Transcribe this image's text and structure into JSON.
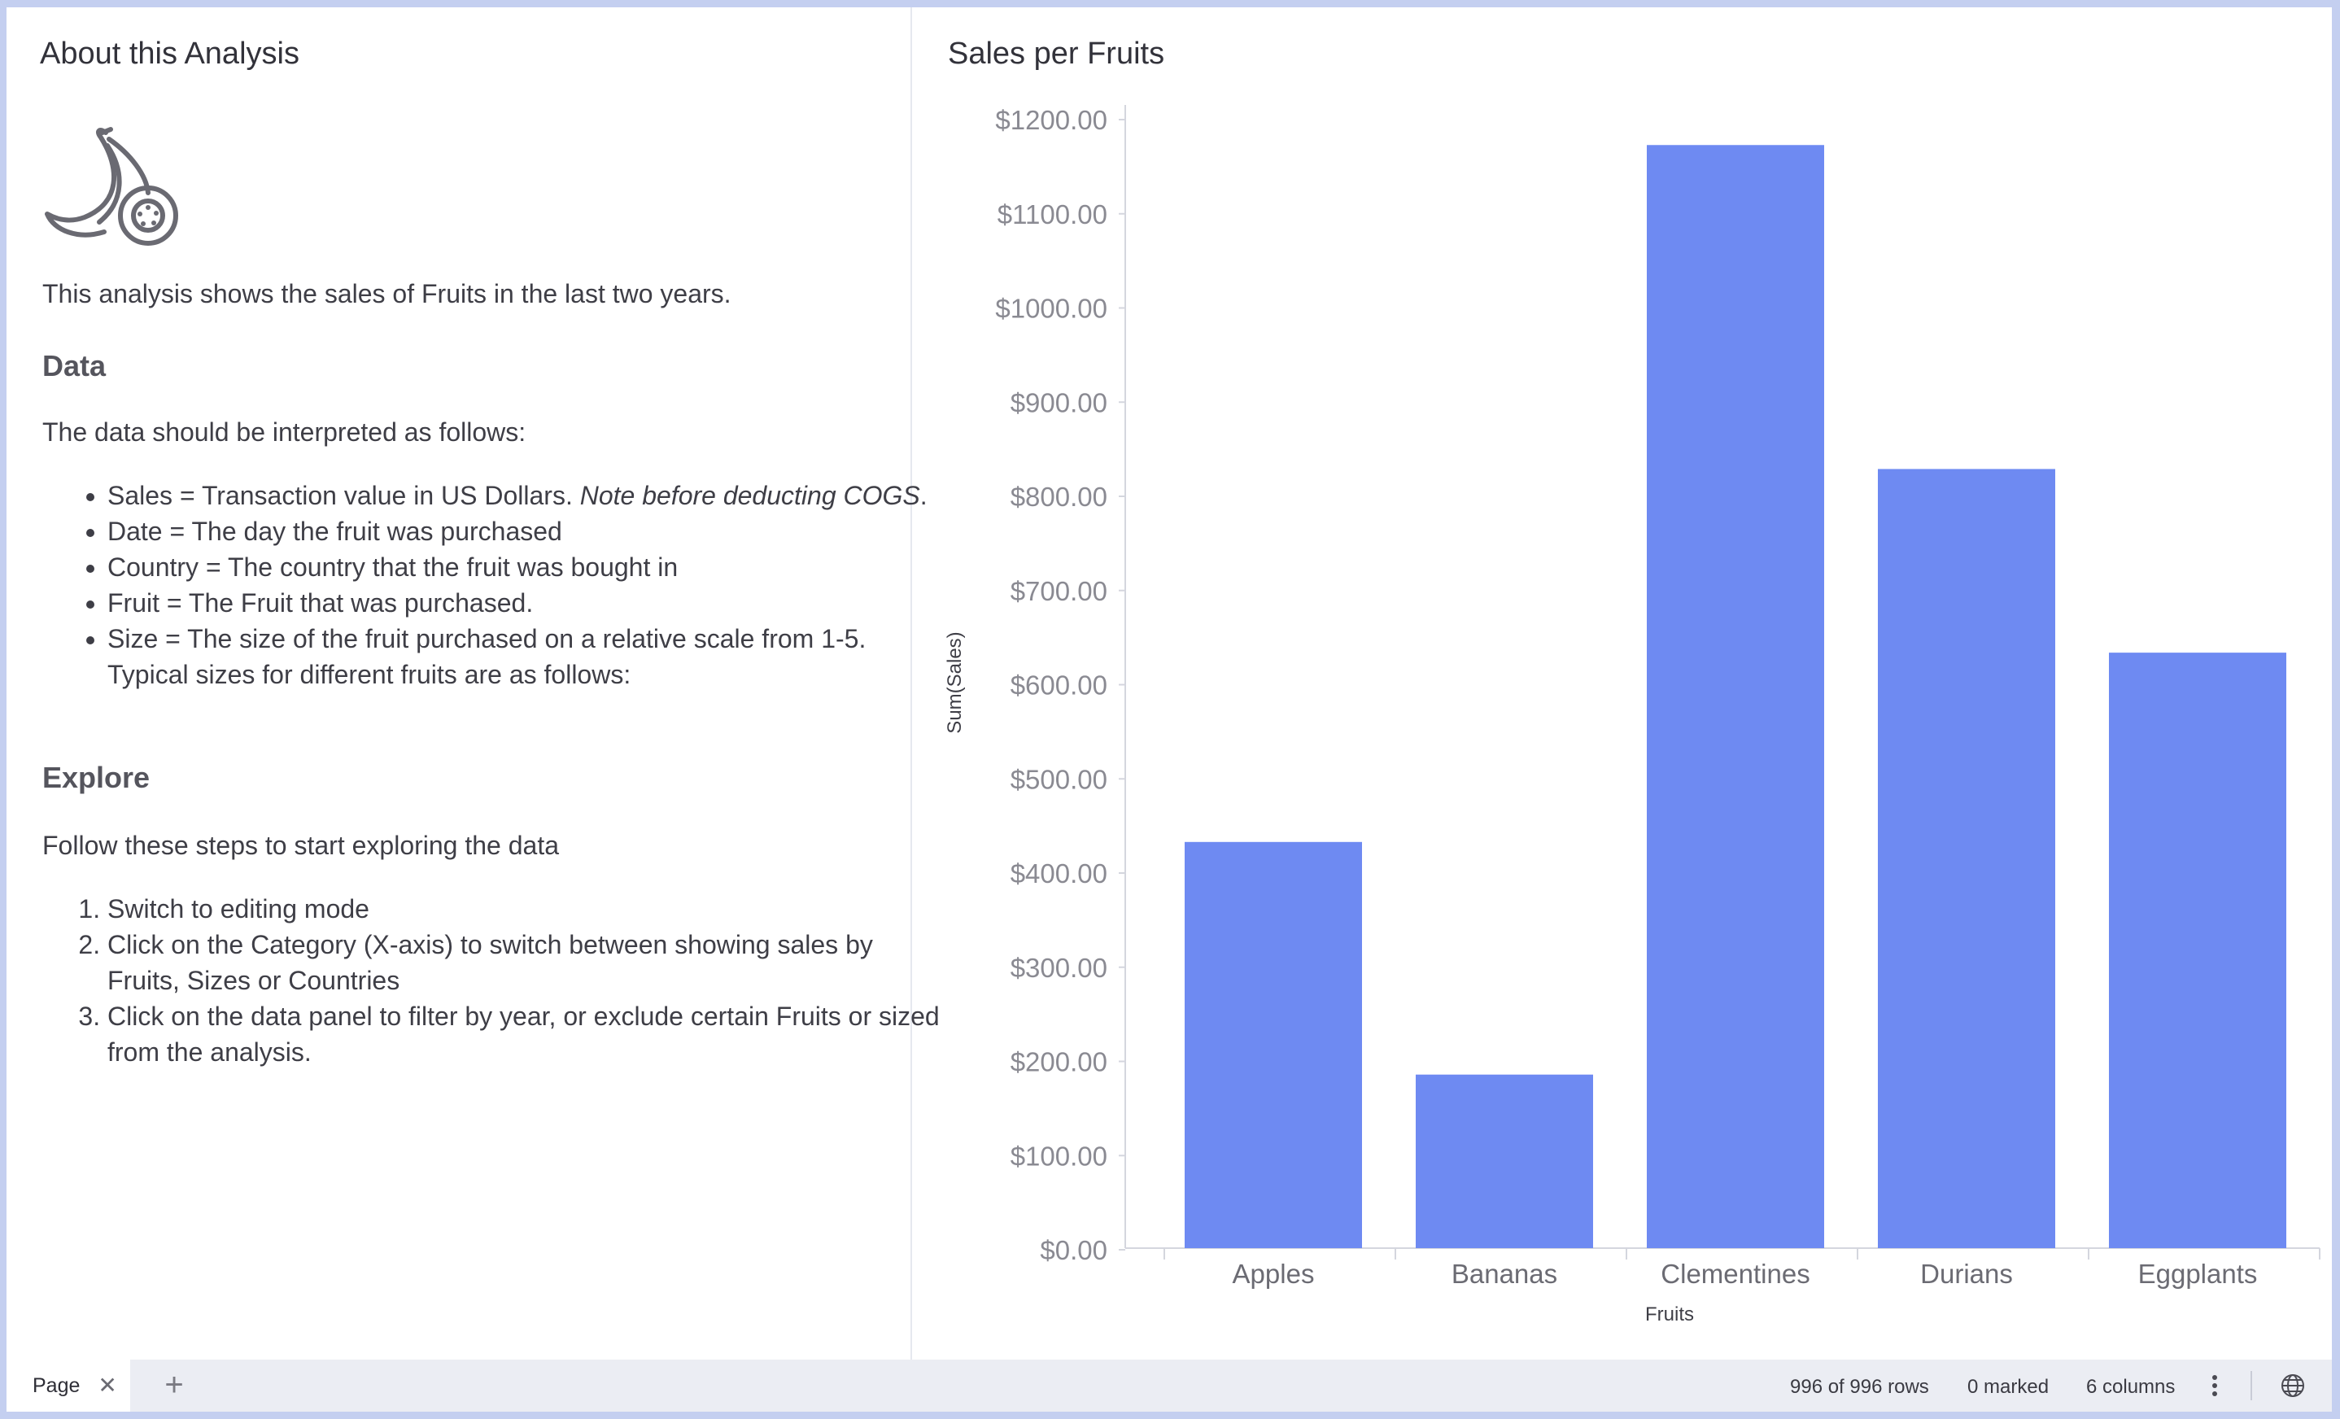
{
  "about": {
    "title": "About this Analysis",
    "intro": "This analysis shows the sales of Fruits in the last two years.",
    "data_heading": "Data",
    "data_intro": "The data should be interpreted as follows:",
    "bullets": [
      {
        "text": "Sales = Transaction value in US Dollars. ",
        "note": "Note before deducting COGS",
        "suffix": "."
      },
      {
        "text": "Date = The day the fruit was purchased"
      },
      {
        "text": "Country = The country that the fruit was bought in"
      },
      {
        "text": "Fruit = The Fruit that was purchased."
      },
      {
        "text": "Size = The size of the fruit purchased on a relative scale from 1-5. Typical sizes for different fruits are as follows:"
      }
    ],
    "explore_heading": "Explore",
    "explore_intro": "Follow these steps to start exploring the data",
    "steps": [
      "Switch to editing mode",
      "Click on the Category (X-axis) to switch between showing sales by Fruits, Sizes or Countries",
      "Click on the data panel to filter by year, or exclude certain Fruits or sized from the analysis."
    ],
    "logo_icon": "banana-kiwi-icon"
  },
  "chart_panel": {
    "title": "Sales per Fruits"
  },
  "chart_data": {
    "type": "bar",
    "categories": [
      "Apples",
      "Bananas",
      "Clementines",
      "Durians",
      "Eggplants"
    ],
    "values": [
      433,
      186,
      1173,
      829,
      634
    ],
    "xlabel": "Fruits",
    "ylabel": "Sum(Sales)",
    "ylim": [
      0,
      1200
    ],
    "y_ticks": [
      {
        "value": 0,
        "label": "$0.00"
      },
      {
        "value": 100,
        "label": "$100.00"
      },
      {
        "value": 200,
        "label": "$200.00"
      },
      {
        "value": 300,
        "label": "$300.00"
      },
      {
        "value": 400,
        "label": "$400.00"
      },
      {
        "value": 500,
        "label": "$500.00"
      },
      {
        "value": 600,
        "label": "$600.00"
      },
      {
        "value": 700,
        "label": "$700.00"
      },
      {
        "value": 800,
        "label": "$800.00"
      },
      {
        "value": 900,
        "label": "$900.00"
      },
      {
        "value": 1000,
        "label": "$1000.00"
      },
      {
        "value": 1100,
        "label": "$1100.00"
      },
      {
        "value": 1200,
        "label": "$1200.00"
      }
    ],
    "bar_color": "#6e8af2",
    "grid": false,
    "legend": "none"
  },
  "status_bar": {
    "page_tab": "Page",
    "close_icon": "close-icon",
    "add_icon": "plus-icon",
    "rows": "996 of 996 rows",
    "marked": "0 marked",
    "columns": "6 columns",
    "more_icon": "more-vertical-icon",
    "globe_icon": "globe-icon"
  }
}
